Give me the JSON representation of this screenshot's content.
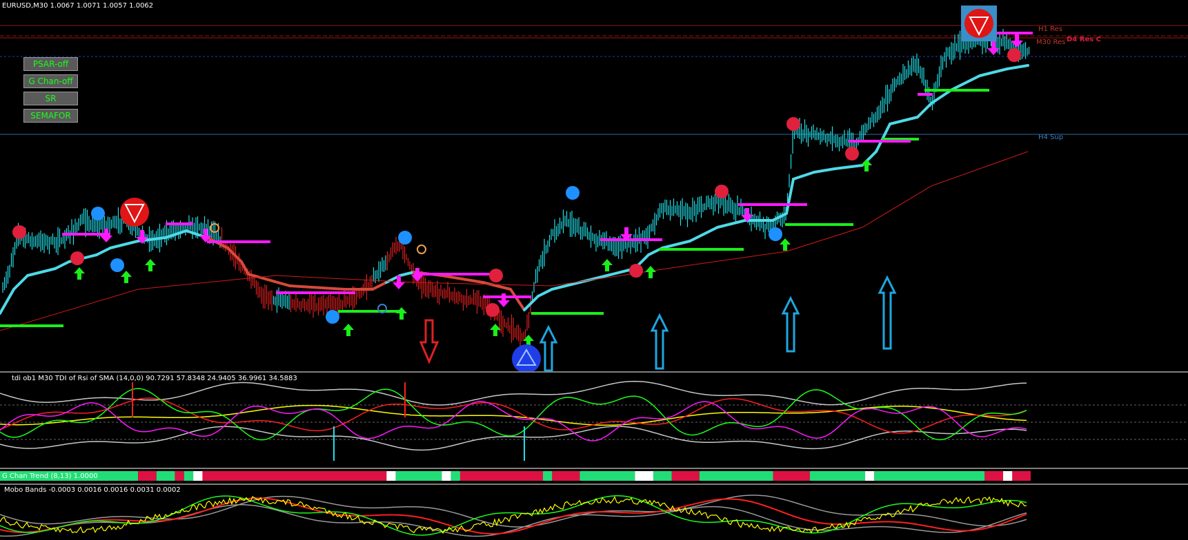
{
  "main": {
    "title": "EURUSD,M30  1.0067 1.0071 1.0057 1.0062",
    "buttons": [
      {
        "label": "PSAR-off"
      },
      {
        "label": "G Chan-off"
      },
      {
        "label": "SR"
      },
      {
        "label": "SEMAFOR"
      }
    ],
    "levels": [
      {
        "label": "H1 Res",
        "color": "#c0392b"
      },
      {
        "label": "M30 Res",
        "color": "#c0392b"
      },
      {
        "label": "D4 Res C",
        "color": "#d21f3c"
      },
      {
        "label": "H4 Sup",
        "color": "#3a7fc1"
      }
    ],
    "colors": {
      "price_cyan": "#22e0e8",
      "price_red": "#e02020",
      "trail": "#4fd9e6",
      "ma": "#d01a1a",
      "green": "#1aef1a",
      "magenta": "#ff19ff"
    }
  },
  "tdi": {
    "title": "tdi ob1 M30 TDI of Rsi of SMA (14,0,0) 90.7291 57.8348 24.9405 36.9961 34.5883"
  },
  "gchan": {
    "title": "G Chan Trend (8,13) 1.0000",
    "segments": [
      [
        "g",
        15
      ],
      [
        "r",
        2
      ],
      [
        "g",
        2
      ],
      [
        "r",
        1
      ],
      [
        "g",
        1
      ],
      [
        "w",
        1
      ],
      [
        "r",
        20
      ],
      [
        "w",
        1
      ],
      [
        "g",
        5
      ],
      [
        "w",
        1
      ],
      [
        "g",
        1
      ],
      [
        "r",
        9
      ],
      [
        "g",
        1
      ],
      [
        "r",
        3
      ],
      [
        "g",
        6
      ],
      [
        "w",
        2
      ],
      [
        "g",
        2
      ],
      [
        "r",
        3
      ],
      [
        "g",
        8
      ],
      [
        "r",
        4
      ],
      [
        "g",
        6
      ],
      [
        "w",
        1
      ],
      [
        "g",
        12
      ],
      [
        "r",
        2
      ],
      [
        "w",
        1
      ],
      [
        "r",
        2
      ]
    ]
  },
  "mobo": {
    "title": "Mobo Bands -0.0003 0.0016 0.0016 0.0031 0.0002"
  }
}
